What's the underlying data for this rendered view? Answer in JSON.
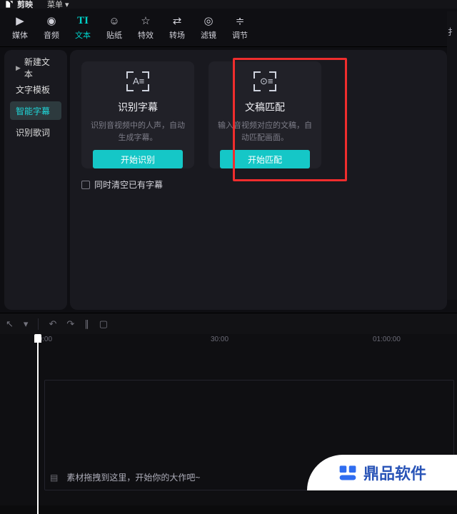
{
  "titlebar": {
    "app_name": "剪映",
    "menu_label": "菜单"
  },
  "top_tabs": [
    {
      "icon": "▶",
      "label": "媒体"
    },
    {
      "icon": "◉",
      "label": "音频"
    },
    {
      "icon": "TI",
      "label": "文本",
      "active": true
    },
    {
      "icon": "☺",
      "label": "贴纸"
    },
    {
      "icon": "☆",
      "label": "特效"
    },
    {
      "icon": "⇄",
      "label": "转场"
    },
    {
      "icon": "◎",
      "label": "滤镜"
    },
    {
      "icon": "≑",
      "label": "调节"
    }
  ],
  "sidebar": {
    "items": [
      {
        "label": "新建文本",
        "expandable": true
      },
      {
        "label": "文字模板"
      },
      {
        "label": "智能字幕",
        "active": true
      },
      {
        "label": "识别歌词"
      }
    ]
  },
  "cards": {
    "subtitle": {
      "title": "识别字幕",
      "desc": "识别音视频中的人声，自动生成字幕。",
      "button": "开始识别",
      "icon_glyph": "A≡"
    },
    "transcript": {
      "title": "文稿匹配",
      "desc": "输入音视频对应的文稿，自动匹配画面。",
      "button": "开始匹配",
      "icon_glyph": "⊙≡"
    }
  },
  "checkbox_label": "同时清空已有字幕",
  "right_panel_glyph": "扌",
  "timeline": {
    "ticks": [
      {
        "pos": 48,
        "label": "00:00"
      },
      {
        "pos": 295,
        "label": "30:00"
      },
      {
        "pos": 522,
        "label": "01:00:00"
      }
    ],
    "dropzone_hint": "素材拖拽到这里，开始你的大作吧~"
  },
  "watermark": {
    "text": "鼎品软件"
  }
}
